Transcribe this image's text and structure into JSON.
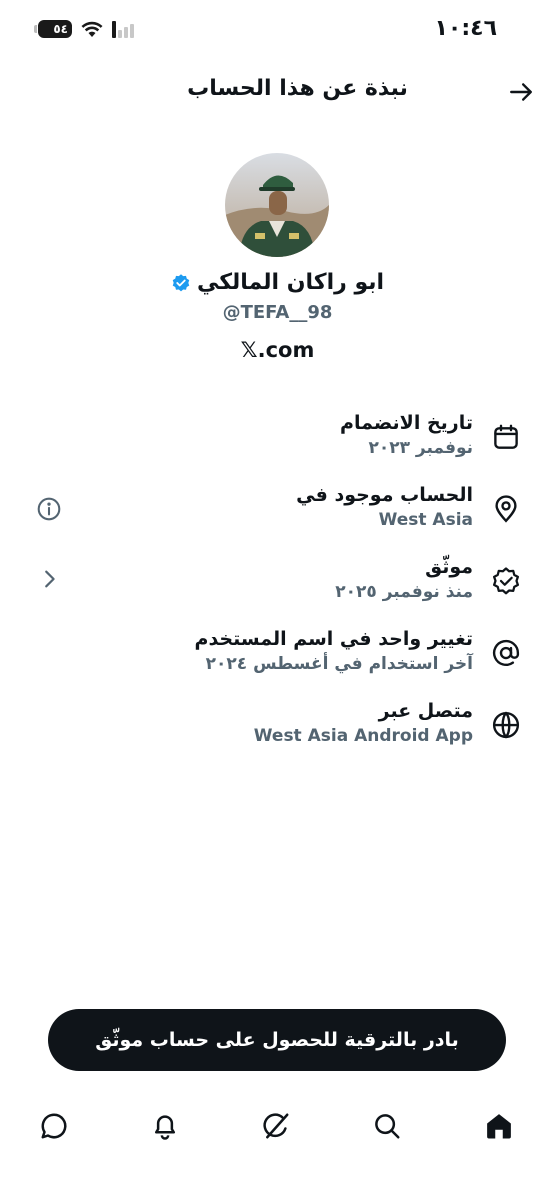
{
  "status_bar": {
    "time": "١٠:٤٦",
    "battery": "٥٤"
  },
  "header": {
    "title": "نبذة عن هذا الحساب"
  },
  "profile": {
    "name": "ابو راكان المالكي",
    "handle": "@TEFA__98",
    "link": "𝕏.com",
    "verified_color": "#1d9bf0"
  },
  "info": [
    {
      "title": "تاريخ الانضمام",
      "value": "نوفمبر ٢٠٢٣",
      "icon": "calendar-icon"
    },
    {
      "title": "الحساب موجود في",
      "value": "West Asia",
      "icon": "location-pin-icon"
    },
    {
      "title": "موثّق",
      "value": "منذ نوفمبر ٢٠٢٥",
      "icon": "verified-badge-icon"
    },
    {
      "title": "تغيير واحد في اسم المستخدم",
      "value": "آخر استخدام في أغسطس ٢٠٢٤",
      "icon": "at-sign-icon"
    },
    {
      "title": "متصل عبر",
      "value": "West Asia Android App",
      "icon": "globe-icon"
    }
  ],
  "upgrade_button": {
    "label": "بادر بالترقية للحصول على حساب موثّق"
  },
  "nav": [
    "home-icon",
    "search-icon",
    "grok-icon",
    "notifications-icon",
    "messages-icon"
  ]
}
